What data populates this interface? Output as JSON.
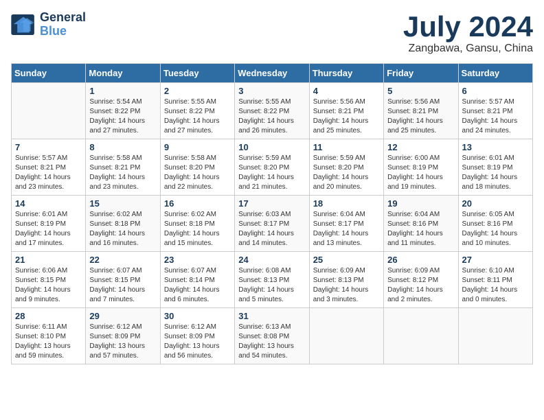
{
  "logo": {
    "line1": "General",
    "line2": "Blue"
  },
  "title": "July 2024",
  "subtitle": "Zangbawa, Gansu, China",
  "headers": [
    "Sunday",
    "Monday",
    "Tuesday",
    "Wednesday",
    "Thursday",
    "Friday",
    "Saturday"
  ],
  "weeks": [
    [
      {
        "day": "",
        "info": ""
      },
      {
        "day": "1",
        "info": "Sunrise: 5:54 AM\nSunset: 8:22 PM\nDaylight: 14 hours\nand 27 minutes."
      },
      {
        "day": "2",
        "info": "Sunrise: 5:55 AM\nSunset: 8:22 PM\nDaylight: 14 hours\nand 27 minutes."
      },
      {
        "day": "3",
        "info": "Sunrise: 5:55 AM\nSunset: 8:22 PM\nDaylight: 14 hours\nand 26 minutes."
      },
      {
        "day": "4",
        "info": "Sunrise: 5:56 AM\nSunset: 8:21 PM\nDaylight: 14 hours\nand 25 minutes."
      },
      {
        "day": "5",
        "info": "Sunrise: 5:56 AM\nSunset: 8:21 PM\nDaylight: 14 hours\nand 25 minutes."
      },
      {
        "day": "6",
        "info": "Sunrise: 5:57 AM\nSunset: 8:21 PM\nDaylight: 14 hours\nand 24 minutes."
      }
    ],
    [
      {
        "day": "7",
        "info": "Sunrise: 5:57 AM\nSunset: 8:21 PM\nDaylight: 14 hours\nand 23 minutes."
      },
      {
        "day": "8",
        "info": "Sunrise: 5:58 AM\nSunset: 8:21 PM\nDaylight: 14 hours\nand 23 minutes."
      },
      {
        "day": "9",
        "info": "Sunrise: 5:58 AM\nSunset: 8:20 PM\nDaylight: 14 hours\nand 22 minutes."
      },
      {
        "day": "10",
        "info": "Sunrise: 5:59 AM\nSunset: 8:20 PM\nDaylight: 14 hours\nand 21 minutes."
      },
      {
        "day": "11",
        "info": "Sunrise: 5:59 AM\nSunset: 8:20 PM\nDaylight: 14 hours\nand 20 minutes."
      },
      {
        "day": "12",
        "info": "Sunrise: 6:00 AM\nSunset: 8:19 PM\nDaylight: 14 hours\nand 19 minutes."
      },
      {
        "day": "13",
        "info": "Sunrise: 6:01 AM\nSunset: 8:19 PM\nDaylight: 14 hours\nand 18 minutes."
      }
    ],
    [
      {
        "day": "14",
        "info": "Sunrise: 6:01 AM\nSunset: 8:19 PM\nDaylight: 14 hours\nand 17 minutes."
      },
      {
        "day": "15",
        "info": "Sunrise: 6:02 AM\nSunset: 8:18 PM\nDaylight: 14 hours\nand 16 minutes."
      },
      {
        "day": "16",
        "info": "Sunrise: 6:02 AM\nSunset: 8:18 PM\nDaylight: 14 hours\nand 15 minutes."
      },
      {
        "day": "17",
        "info": "Sunrise: 6:03 AM\nSunset: 8:17 PM\nDaylight: 14 hours\nand 14 minutes."
      },
      {
        "day": "18",
        "info": "Sunrise: 6:04 AM\nSunset: 8:17 PM\nDaylight: 14 hours\nand 13 minutes."
      },
      {
        "day": "19",
        "info": "Sunrise: 6:04 AM\nSunset: 8:16 PM\nDaylight: 14 hours\nand 11 minutes."
      },
      {
        "day": "20",
        "info": "Sunrise: 6:05 AM\nSunset: 8:16 PM\nDaylight: 14 hours\nand 10 minutes."
      }
    ],
    [
      {
        "day": "21",
        "info": "Sunrise: 6:06 AM\nSunset: 8:15 PM\nDaylight: 14 hours\nand 9 minutes."
      },
      {
        "day": "22",
        "info": "Sunrise: 6:07 AM\nSunset: 8:15 PM\nDaylight: 14 hours\nand 7 minutes."
      },
      {
        "day": "23",
        "info": "Sunrise: 6:07 AM\nSunset: 8:14 PM\nDaylight: 14 hours\nand 6 minutes."
      },
      {
        "day": "24",
        "info": "Sunrise: 6:08 AM\nSunset: 8:13 PM\nDaylight: 14 hours\nand 5 minutes."
      },
      {
        "day": "25",
        "info": "Sunrise: 6:09 AM\nSunset: 8:13 PM\nDaylight: 14 hours\nand 3 minutes."
      },
      {
        "day": "26",
        "info": "Sunrise: 6:09 AM\nSunset: 8:12 PM\nDaylight: 14 hours\nand 2 minutes."
      },
      {
        "day": "27",
        "info": "Sunrise: 6:10 AM\nSunset: 8:11 PM\nDaylight: 14 hours\nand 0 minutes."
      }
    ],
    [
      {
        "day": "28",
        "info": "Sunrise: 6:11 AM\nSunset: 8:10 PM\nDaylight: 13 hours\nand 59 minutes."
      },
      {
        "day": "29",
        "info": "Sunrise: 6:12 AM\nSunset: 8:09 PM\nDaylight: 13 hours\nand 57 minutes."
      },
      {
        "day": "30",
        "info": "Sunrise: 6:12 AM\nSunset: 8:09 PM\nDaylight: 13 hours\nand 56 minutes."
      },
      {
        "day": "31",
        "info": "Sunrise: 6:13 AM\nSunset: 8:08 PM\nDaylight: 13 hours\nand 54 minutes."
      },
      {
        "day": "",
        "info": ""
      },
      {
        "day": "",
        "info": ""
      },
      {
        "day": "",
        "info": ""
      }
    ]
  ]
}
